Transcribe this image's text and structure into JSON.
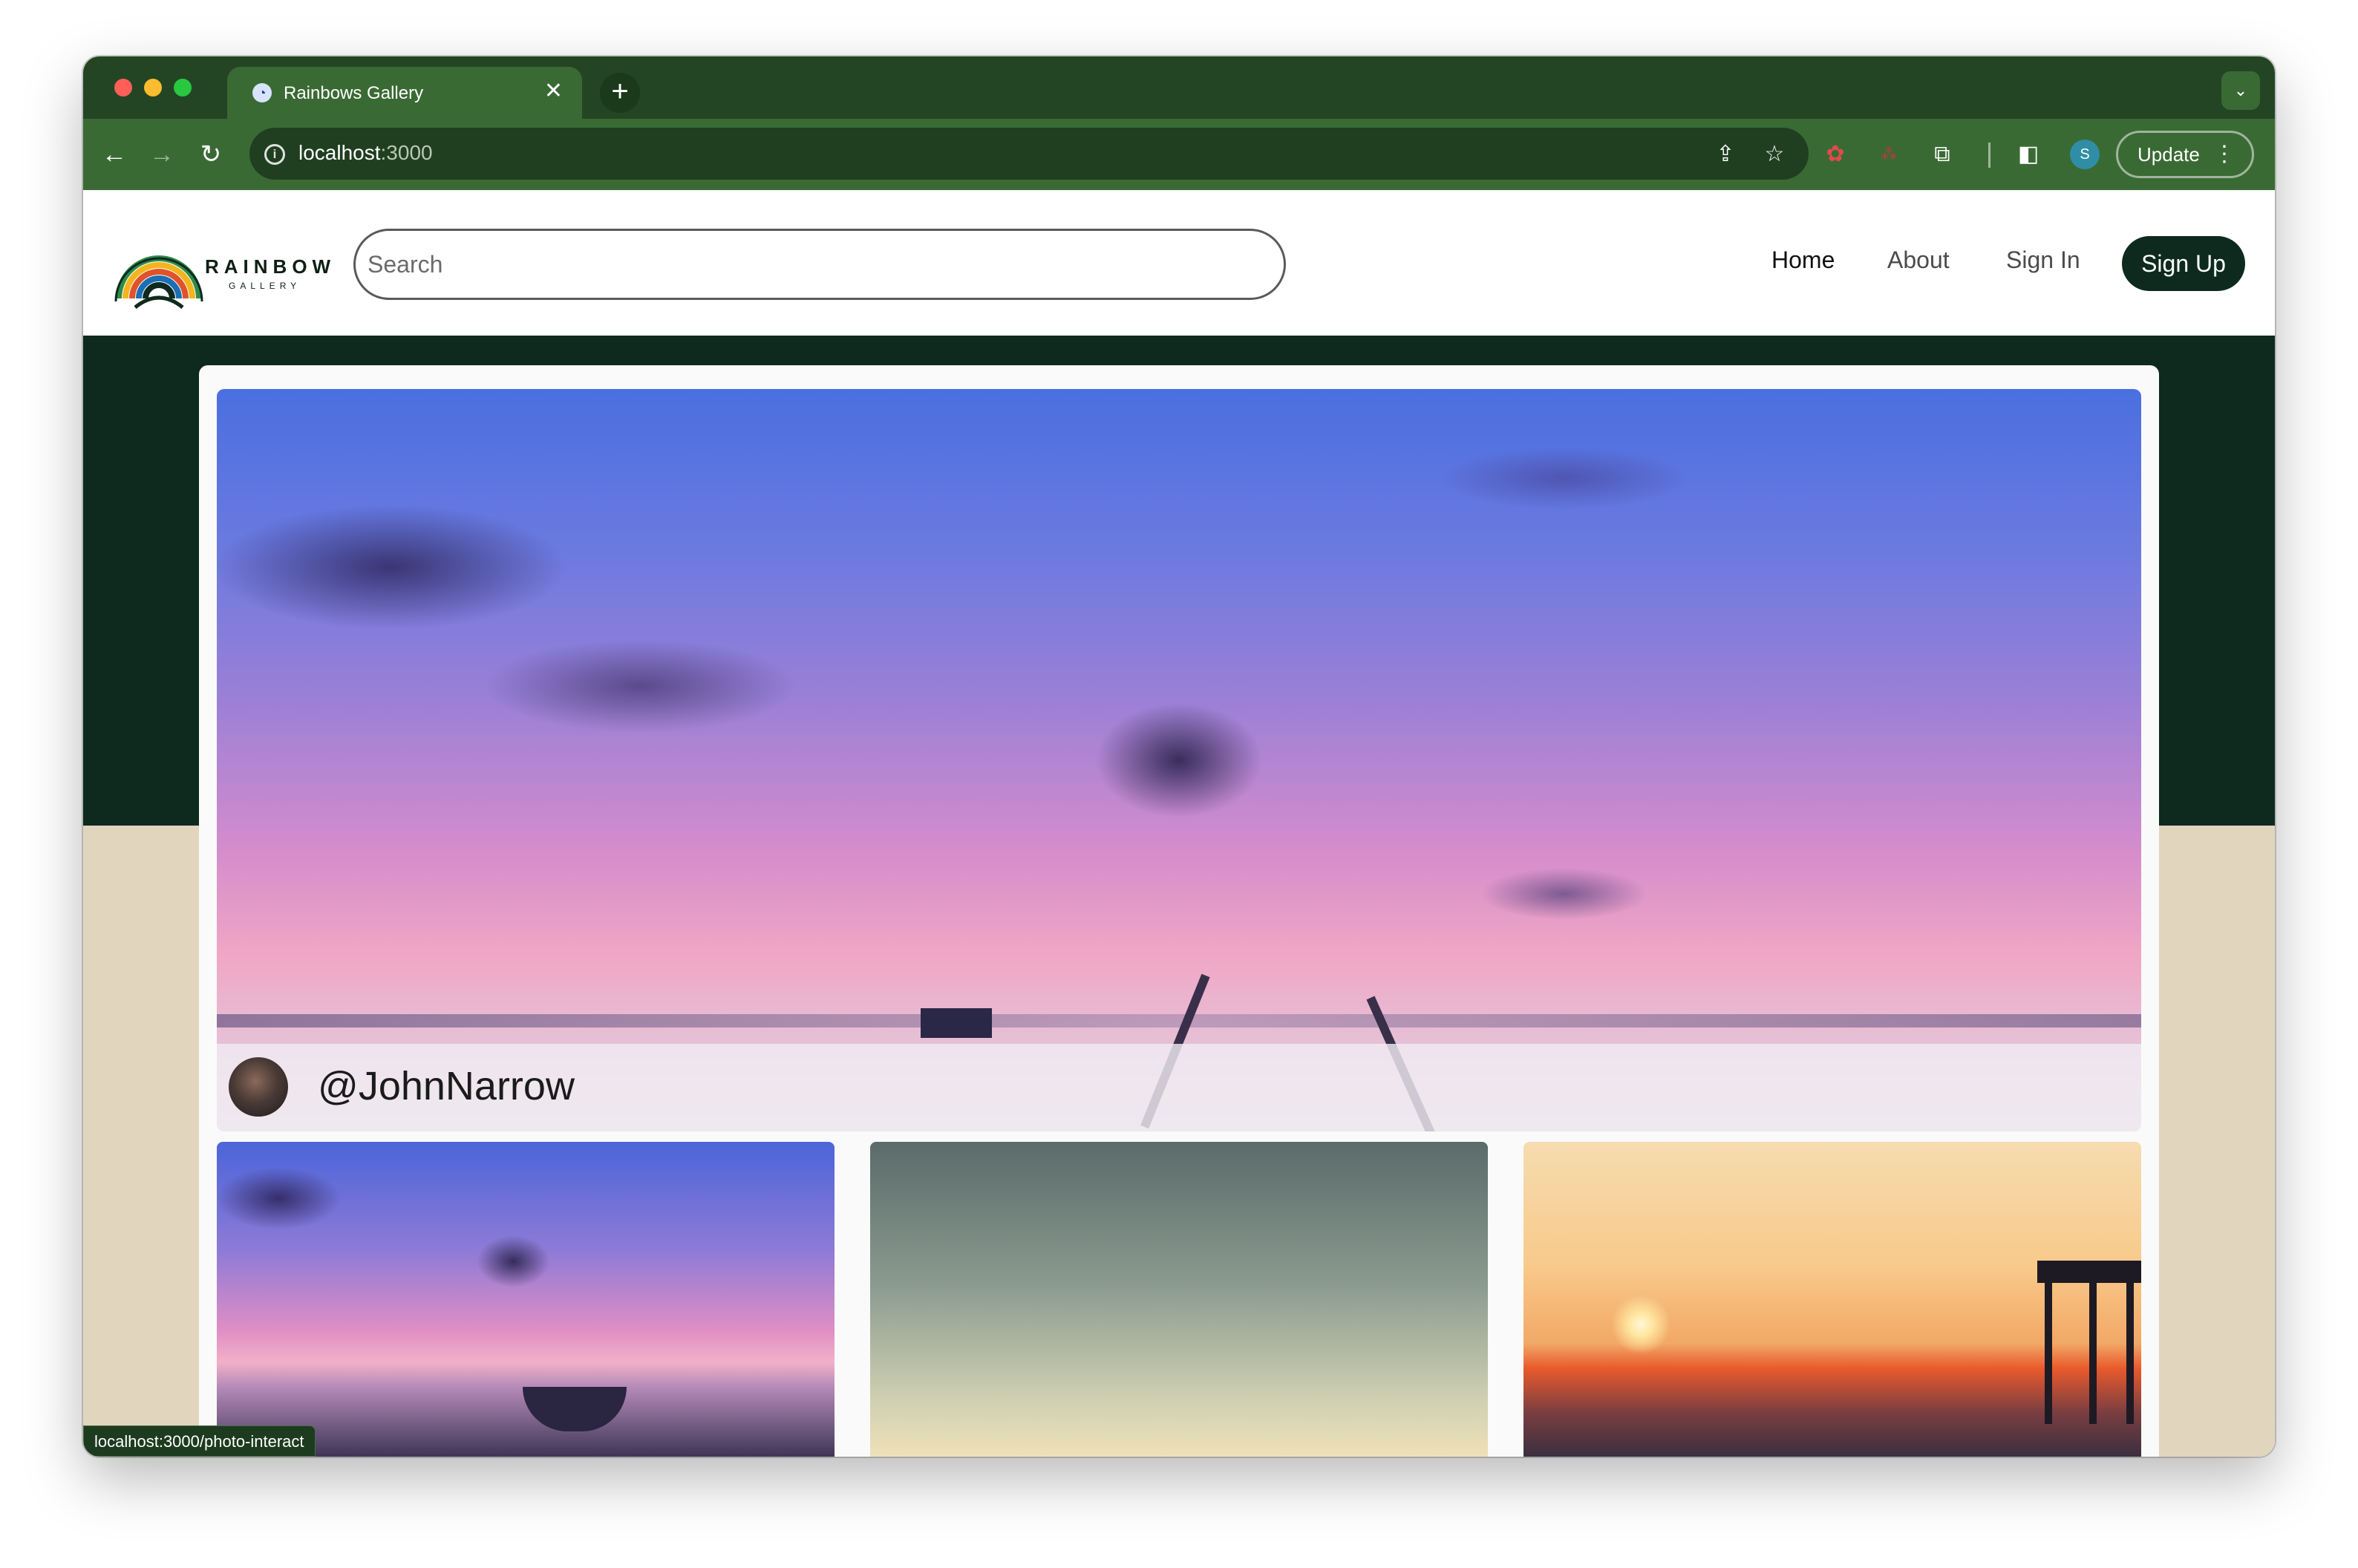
{
  "browser": {
    "tab_title": "Rainbows Gallery",
    "tab_close": "✕",
    "new_tab": "+",
    "url_host": "localhost",
    "url_port": ":3000",
    "update_label": "Update",
    "profile_initial": "S",
    "status_url": "localhost:3000/photo-interact"
  },
  "site": {
    "logo_text": "RAINBOW",
    "logo_sub": "GALLERY",
    "search_placeholder": "Search",
    "nav": {
      "home": "Home",
      "about": "About",
      "signin": "Sign In",
      "signup": "Sign Up"
    },
    "colors": {
      "header_dark": "#0e2a1f",
      "tan": "#e1d5bd",
      "chrome_green": "#3a6a34"
    }
  },
  "feature": {
    "username": "@JohnNarrow"
  },
  "thumbnails": [
    {
      "subject": "sunset-boat"
    },
    {
      "subject": "gradient-sky"
    },
    {
      "subject": "sunset-pier"
    }
  ]
}
